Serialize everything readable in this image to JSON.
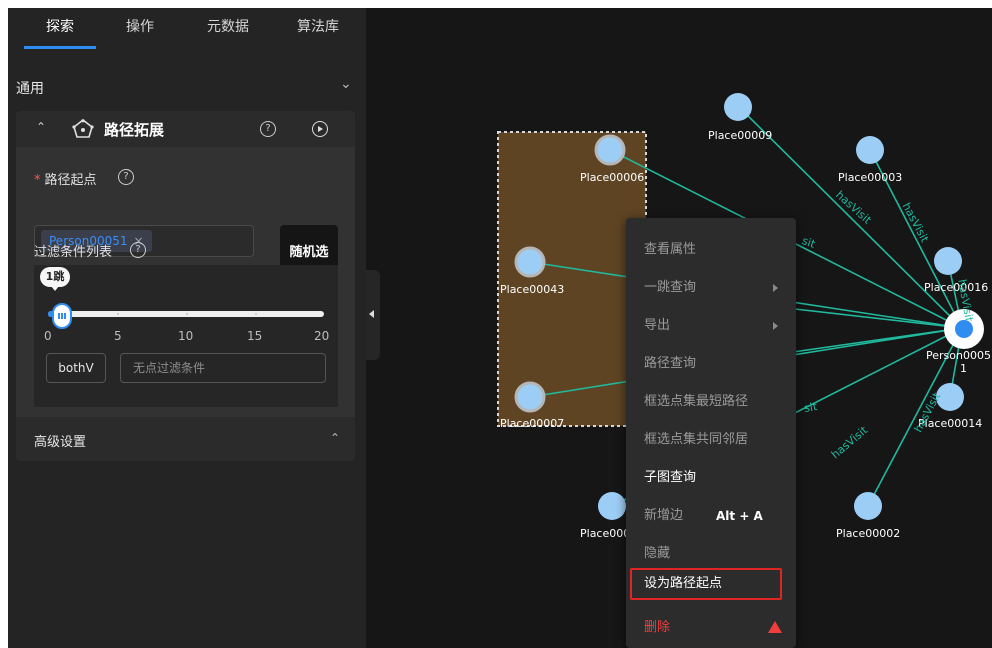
{
  "tabs": [
    "探索",
    "操作",
    "元数据",
    "算法库"
  ],
  "section": {
    "title": "通用"
  },
  "card": {
    "title": "路径拓展",
    "start_label": "路径起点",
    "start_value": "Person00051",
    "random_button": "随机选",
    "filter_label": "过滤条件列表",
    "slider": {
      "value": 1,
      "value_label": "1跳",
      "min": 0,
      "max": 20,
      "ticks": [
        "0",
        "5",
        "10",
        "15",
        "20"
      ]
    },
    "direction_button": "bothV",
    "filter_placeholder": "无点过滤条件",
    "advanced": "高级设置"
  },
  "graph": {
    "nodes": {
      "place00009": "Place00009",
      "place00006": "Place00006",
      "place00003": "Place00003",
      "place00043": "Place00043",
      "place00016": "Place00016",
      "person0005": "Person0005",
      "person_suffix": "1",
      "place00007": "Place00007",
      "place00014": "Place00014",
      "place000_partial": "Place000",
      "place00002": "Place00002"
    },
    "edge_labels": [
      "hasVisit",
      "hasVisit",
      "sit",
      "sit",
      "hasVisit",
      "hasVisit",
      "hasVisit"
    ],
    "colors": {
      "edge": "#20b99e",
      "node": "#9ccdf5",
      "selection_fill": "#5e4423",
      "center": "#2f8cf0"
    }
  },
  "context_menu": {
    "items": [
      "查看属性",
      "一跳查询",
      "导出",
      "路径查询",
      "框选点集最短路径",
      "框选点集共同邻居",
      "子图查询",
      "新增边",
      "隐藏",
      "设为路径起点",
      "删除"
    ],
    "add_edge_shortcut": "Alt + A"
  }
}
